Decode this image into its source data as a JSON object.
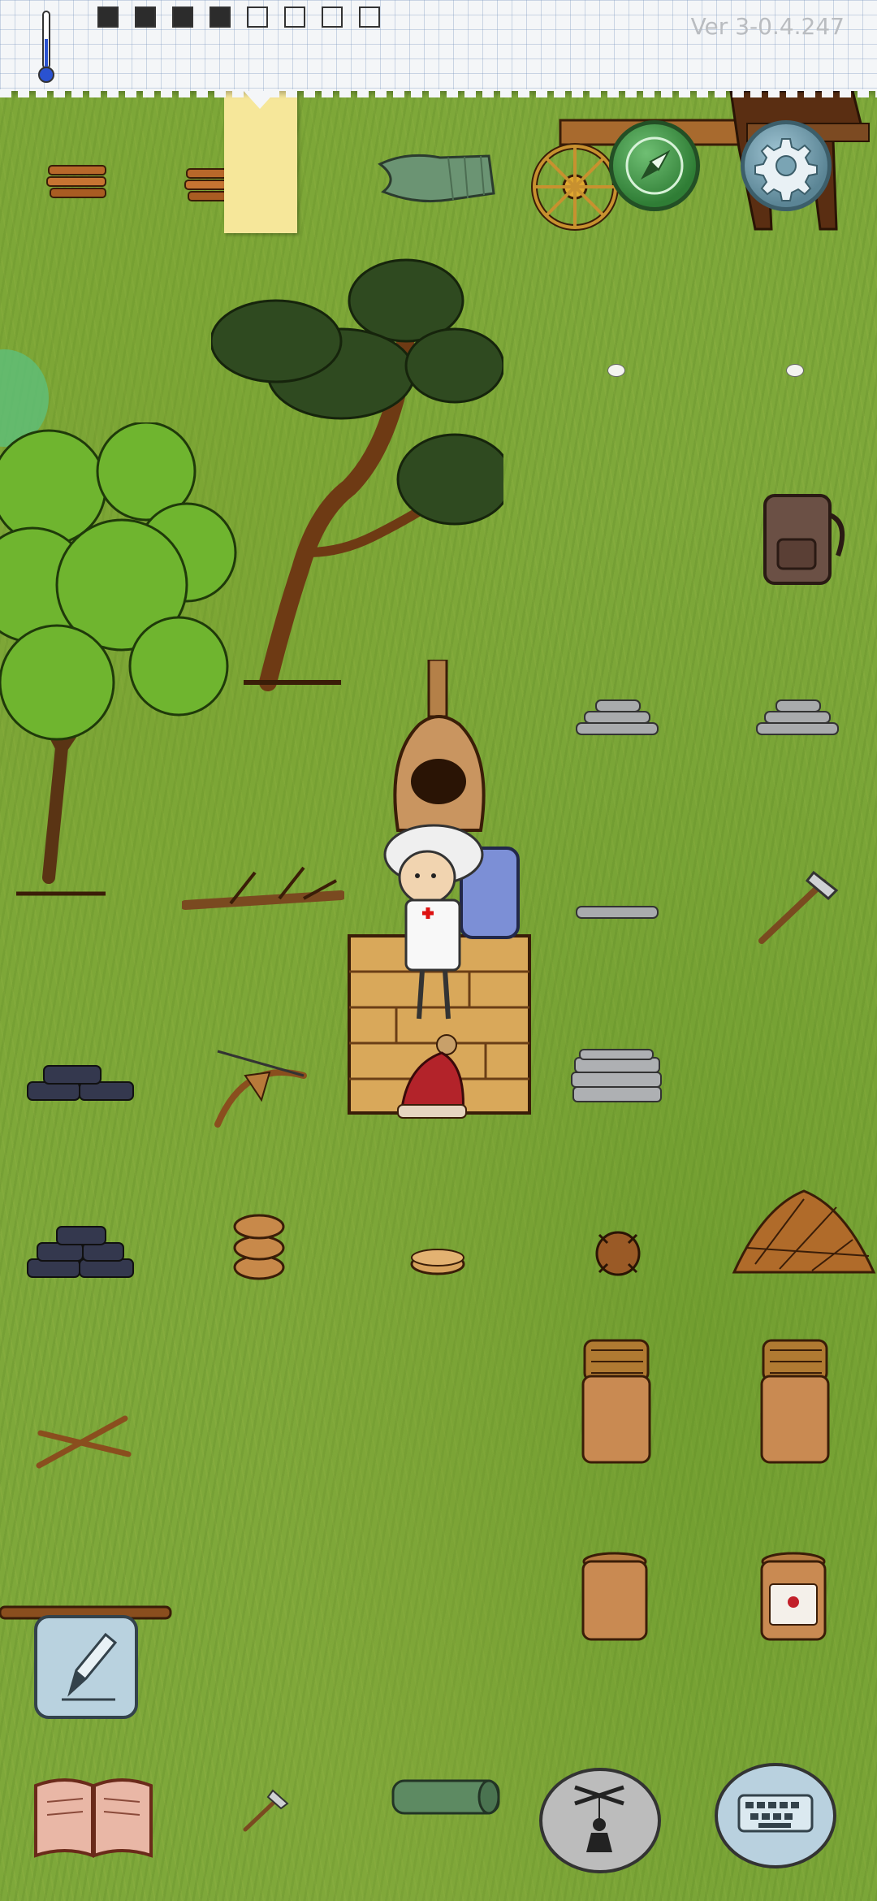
{
  "app": {
    "version_label": "Ver 3-0.4.247"
  },
  "hud": {
    "food_boxes_total": 8,
    "food_boxes_filled": 4,
    "icons": {
      "temperature": "thermometer-icon",
      "settings": "gear-icon",
      "compass": "compass-icon"
    },
    "colors": {
      "compass_button": "#3c9a44",
      "settings_button": "#7aa4b4",
      "note": "#f6e79a",
      "ground": "#7ea83a"
    }
  },
  "controls": {
    "pencil": "pencil-icon",
    "book": "book-icon",
    "puppet": "puppet-icon",
    "keyboard": "keyboard-icon"
  },
  "world_items": [
    "kindling",
    "kindling",
    "stone-hoe-blade",
    "horse-cart",
    "pine-tree",
    "maple-tree",
    "backpack",
    "clay-kiln",
    "flat-stones",
    "flat-stones",
    "branch",
    "flat-stone",
    "stone-axe",
    "wooden-floor",
    "character",
    "fire-bow",
    "charcoal-pile",
    "red-hat",
    "slate-stack",
    "charcoal-pile",
    "clay-bowls",
    "clay-plate",
    "burr-knot",
    "straw-pile",
    "basket-crock",
    "basket-crock",
    "crossed-sticks",
    "clay-crock",
    "clay-crock-labeled",
    "long-pole",
    "small-hatchet",
    "rolled-mat",
    "small-pebbles"
  ]
}
